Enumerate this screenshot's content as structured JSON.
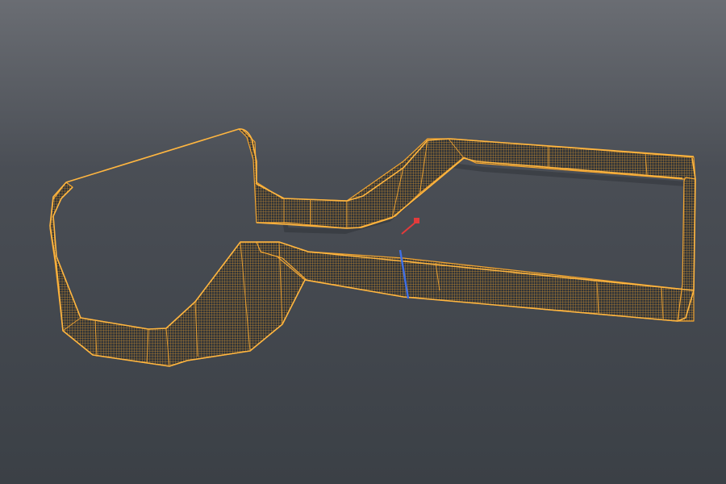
{
  "viewport": {
    "name": "3d-viewport",
    "background_top": "#6a6d73",
    "background_mid": "#4a4e55",
    "background_bottom": "#3b4046",
    "shadow_color": "#31353a"
  },
  "mesh": {
    "name": "track-wall-mesh",
    "wire_color": "#f2a531",
    "edge_color": "#ffb640",
    "fill_color": "#2f3338",
    "display_mode": "wireframe",
    "selected": true
  },
  "gizmo": {
    "x_axis_color": "#e23b3b",
    "y_axis_color": "#3f6fe6"
  }
}
